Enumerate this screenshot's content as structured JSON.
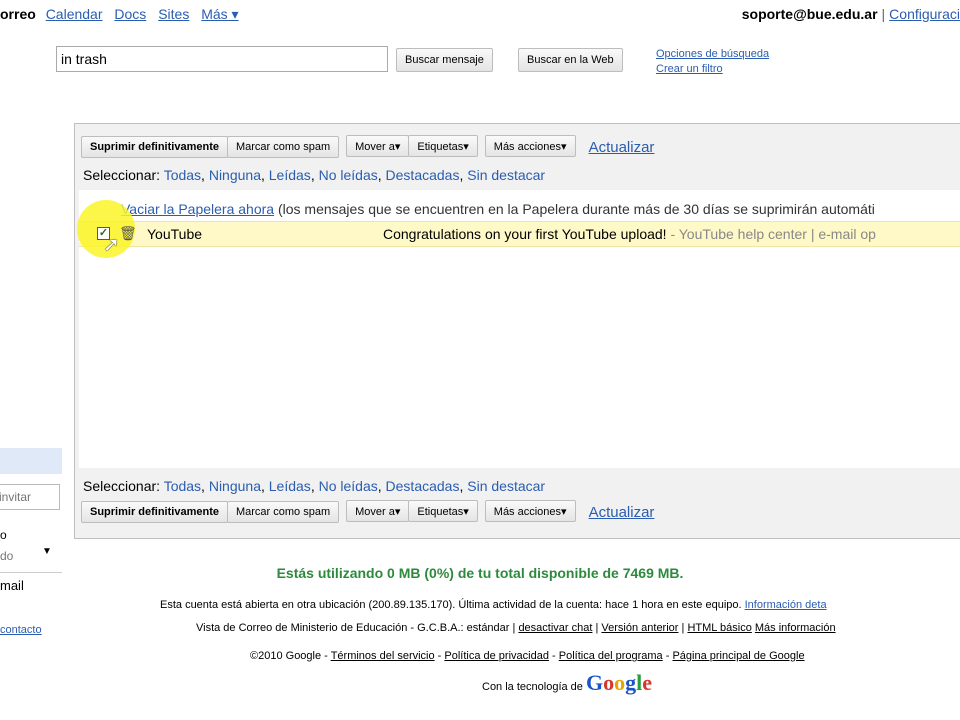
{
  "topnav": {
    "brand": "orreo",
    "links": [
      "Calendar",
      "Docs",
      "Sites"
    ],
    "more": "Más ▾"
  },
  "user": {
    "email": "soporte@bue.edu.ar",
    "settings": "Configuraci"
  },
  "search": {
    "value": "in trash",
    "search_mail_button": "Buscar mensaje",
    "search_web_button": "Buscar en la Web",
    "options_link": "Opciones de búsqueda",
    "filter_link": "Crear un filtro"
  },
  "toolbar": {
    "delete_forever": "Suprimir definitivamente",
    "mark_spam": "Marcar como spam",
    "move_to": "Mover a▾",
    "labels": "Etiquetas▾",
    "more_actions": "Más acciones▾",
    "refresh": "Actualizar"
  },
  "select": {
    "label": "Seleccionar:",
    "options": [
      "Todas",
      "Ninguna",
      "Leídas",
      "No leídas",
      "Destacadas",
      "Sin destacar"
    ]
  },
  "trash_notice": {
    "link": "Vaciar la Papelera ahora",
    "text": " (los mensajes que se encuentren en la Papelera durante más de 30 días se suprimirán automáti"
  },
  "messages": [
    {
      "sender": "YouTube",
      "subject": "Congratulations on your first YouTube upload!",
      "snippet": " - YouTube help center | e-mail op",
      "checked": true
    }
  ],
  "sidebar": {
    "invite_placeholder": "invitar",
    "t1": "o",
    "t2": "do",
    "t3": "mail",
    "t4": "contacto"
  },
  "footer": {
    "usage": "Estás utilizando 0 MB (0%) de tu total disponible de 7469 MB.",
    "line1_text": "Esta cuenta está abierta en otra ubicación (200.89.135.170).   Última actividad de la cuenta: hace 1 hora en este equipo.",
    "line1_link": "Información deta",
    "line2_text": "Vista de Correo de Ministerio de Educación - G.C.B.A.: estándar |",
    "line2_links": [
      "desactivar chat",
      "Versión anterior",
      "HTML básico",
      "Más información"
    ],
    "copyright": "©2010 Google -",
    "line3_links": [
      "Términos del servicio",
      "Política de privacidad",
      "Política del programa",
      "Página principal de Google"
    ],
    "powered": "Con la tecnología de"
  },
  "colors": {
    "link": "#2a5db0",
    "usage_green": "#2d8a3d",
    "row_highlight": "#fff9c8",
    "panel_bg": "#f1f1f1"
  }
}
